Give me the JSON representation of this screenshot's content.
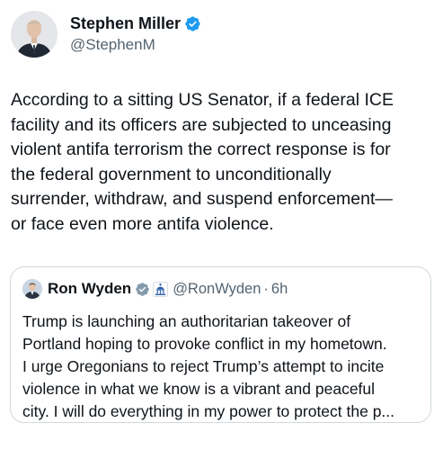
{
  "tweet": {
    "author": {
      "display_name": "Stephen Miller",
      "handle": "@StephenM",
      "verified_color": "#1d9bf0",
      "icons": {
        "verified": "verified-badge-icon"
      }
    },
    "text_lines": [
      "According to a sitting US Senator, if a federal ICE",
      "facility and its officers are subjected to unceasing",
      "violent antifa terrorism the correct response is for",
      "the federal government to unconditionally",
      "surrender, withdraw, and suspend enforcement—",
      "or face even more antifa violence."
    ]
  },
  "quoted_tweet": {
    "author": {
      "display_name": "Ron Wyden",
      "handle": "@RonWyden",
      "separator": "·",
      "time": "6h",
      "icons": {
        "verified": "gray-verified-badge-icon",
        "affiliation": "capitol-building-icon"
      },
      "badge_color": "#829aab"
    },
    "text_lines": [
      "Trump is launching an authoritarian takeover of",
      "Portland hoping to provoke conflict in my hometown.",
      "I urge Oregonians to reject Trump’s attempt to incite",
      "violence in what we know is a vibrant and peaceful",
      "city. I will do everything in my power to protect the p..."
    ]
  },
  "colors": {
    "text_primary": "#0f1419",
    "text_secondary": "#536471",
    "border": "#cfd9de"
  }
}
